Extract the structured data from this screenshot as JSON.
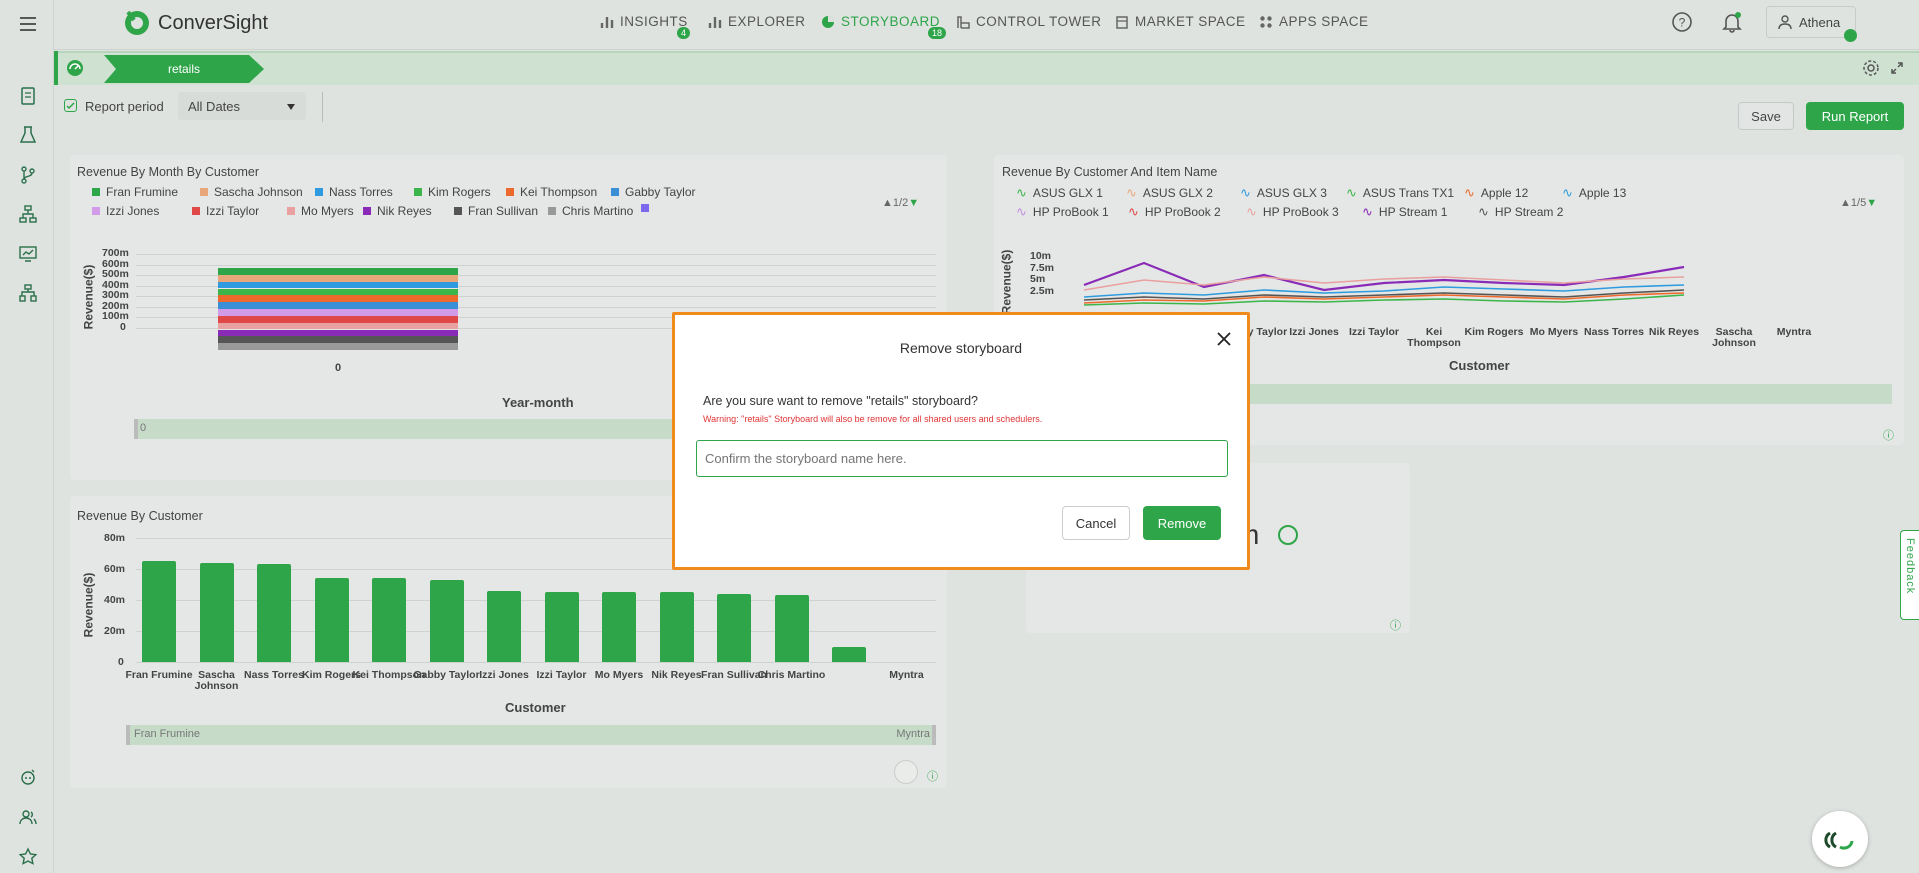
{
  "app": {
    "brand": "ConverSight",
    "accent": "#2fa54a",
    "modal_border": "#f08a1a"
  },
  "nav": {
    "items": [
      {
        "label": "INSIGHTS",
        "icon": "bar-chart-icon",
        "badge": "4"
      },
      {
        "label": "EXPLORER",
        "icon": "bar-chart-icon",
        "badge": ""
      },
      {
        "label": "STORYBOARD",
        "icon": "pie-icon",
        "badge": "18"
      },
      {
        "label": "CONTROL TOWER",
        "icon": "tower-icon",
        "badge": ""
      },
      {
        "label": "MARKET SPACE",
        "icon": "market-icon",
        "badge": ""
      },
      {
        "label": "APPS SPACE",
        "icon": "grid-icon",
        "badge": ""
      }
    ],
    "user": "Athena"
  },
  "breadcrumb": {
    "label": "retails"
  },
  "filter": {
    "report_period_label": "Report period",
    "date_value": "All Dates",
    "save": "Save",
    "run_report": "Run Report"
  },
  "card1": {
    "title": "Revenue By Month By Customer",
    "legend": [
      "Fran Frumine",
      "Sascha Johnson",
      "Nass Torres",
      "Kim Rogers",
      "Kei Thompson",
      "Gabby Taylor",
      "Izzi Jones",
      "Izzi Taylor",
      "Mo Myers",
      "Nik Reyes",
      "Fran Sullivan",
      "Chris Martino",
      ""
    ],
    "legend_colors": [
      "#2fa54a",
      "#e8a77a",
      "#2e9be0",
      "#3cb54a",
      "#ee6a2c",
      "#3a8fd6",
      "#d19be8",
      "#e04848",
      "#e8a0a0",
      "#8a2bb8",
      "#555555",
      "#999999",
      "#7b68ee"
    ],
    "pager": "1/2",
    "y_ticks": [
      "700m",
      "600m",
      "500m",
      "400m",
      "300m",
      "200m",
      "100m",
      "0"
    ],
    "ylabel": "Revenue($)",
    "xlabel": "Year-month",
    "x_tick": "0",
    "slider_label": "0"
  },
  "card2": {
    "title": "Revenue By Customer And Item Name",
    "legend": [
      "ASUS GLX 1",
      "ASUS GLX 2",
      "ASUS GLX 3",
      "ASUS Trans TX1",
      "Apple 12",
      "Apple 13",
      "HP ProBook 1",
      "HP ProBook 2",
      "HP ProBook 3",
      "HP Stream 1",
      "HP Stream 2"
    ],
    "legend_colors": [
      "#3cb54a",
      "#e8a77a",
      "#2e9be0",
      "#3cb54a",
      "#ee6a2c",
      "#2e9be0",
      "#c38ee0",
      "#e04848",
      "#e8a0a0",
      "#8a2bb8",
      "#555555"
    ],
    "pager": "1/5",
    "y_ticks": [
      "10m",
      "7.5m",
      "5m",
      "2.5m"
    ],
    "ylabel": "Revenue($)",
    "xlabel": "Customer",
    "x_ticks": [
      "Gabby Taylor",
      "Izzi Jones",
      "Izzi Taylor",
      "Kei Thompson",
      "Kim Rogers",
      "Mo Myers",
      "Nass Torres",
      "Nik Reyes",
      "Sascha Johnson",
      "Myntra"
    ]
  },
  "card3": {
    "title": "Revenue By Customer",
    "ylabel": "Revenue($)",
    "xlabel": "Customer",
    "y_ticks": [
      "80m",
      "60m",
      "40m",
      "20m",
      "0"
    ],
    "slider_left": "Fran Frumine",
    "slider_right": "Myntra"
  },
  "card4": {
    "partial_text": "m"
  },
  "chart_data": {
    "type": "bar",
    "title": "Revenue By Customer",
    "xlabel": "Customer",
    "ylabel": "Revenue($)",
    "ylim": [
      0,
      80
    ],
    "categories": [
      "Fran Frumine",
      "Sascha Johnson",
      "Nass Torres",
      "Kim Rogers",
      "Kei Thompson",
      "Gabby Taylor",
      "Izzi Jones",
      "Izzi Taylor",
      "Mo Myers",
      "Nik Reyes",
      "Fran Sullivan",
      "Chris Martino",
      "",
      "Myntra"
    ],
    "values": [
      65,
      64,
      63,
      54,
      54,
      53,
      46,
      45,
      45,
      45,
      44,
      43,
      10,
      0
    ]
  },
  "modal": {
    "title": "Remove storyboard",
    "question": "Are you sure want to remove \"retails\" storyboard?",
    "warning": "Warning: \"retails\" Storyboard will also be remove for all shared users and schedulers.",
    "placeholder": "Confirm the storyboard name here.",
    "cancel": "Cancel",
    "remove": "Remove"
  },
  "feedback": "Feedback"
}
